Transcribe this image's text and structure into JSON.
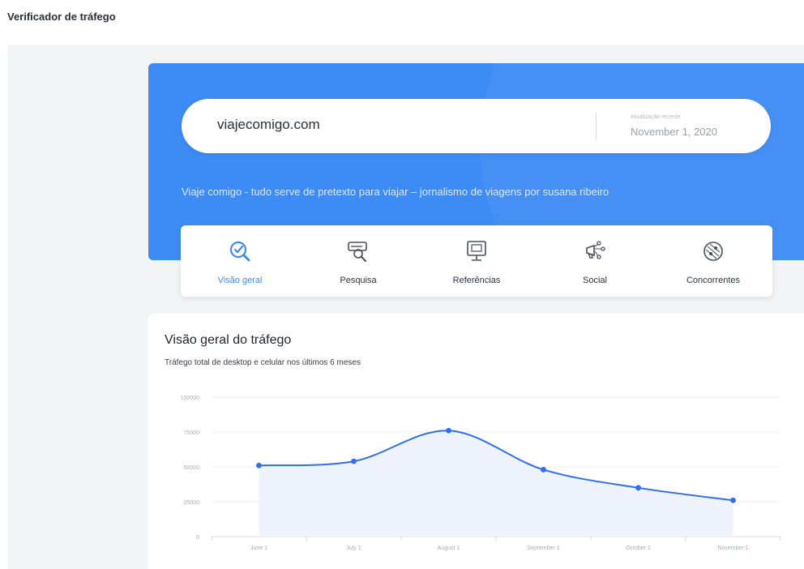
{
  "header": {
    "title": "Verificador de tráfego"
  },
  "hero": {
    "domain": "viajecomigo.com",
    "update_label": "Atualização recente",
    "update_date": "November 1, 2020",
    "tagline": "Viaje comigo - tudo serve de pretexto para viajar – jornalismo de viagens por susana ribeiro",
    "background_color": "#3d8bf5"
  },
  "tabs": [
    {
      "label": "Visão geral",
      "icon": "overview-icon",
      "active": true
    },
    {
      "label": "Pesquisa",
      "icon": "search-icon",
      "active": false
    },
    {
      "label": "Referências",
      "icon": "referrals-icon",
      "active": false
    },
    {
      "label": "Social",
      "icon": "social-icon",
      "active": false
    },
    {
      "label": "Concorrentes",
      "icon": "competitors-icon",
      "active": false
    }
  ],
  "chart_card": {
    "title": "Visão geral do tráfego",
    "subtitle": "Tráfego total de desktop e celular nos últimos 6 meses"
  },
  "chart_data": {
    "type": "area",
    "categories": [
      "June 1",
      "July 1",
      "August 1",
      "September 1",
      "October 1",
      "November 1"
    ],
    "y_ticks": [
      "100000",
      "75000",
      "50000",
      "25000",
      "0"
    ],
    "ylim": [
      0,
      100000
    ],
    "series": [
      {
        "values": [
          51000,
          54000,
          76000,
          48000,
          35000,
          26000
        ],
        "color": "#2f6fed"
      }
    ],
    "grid": true
  }
}
